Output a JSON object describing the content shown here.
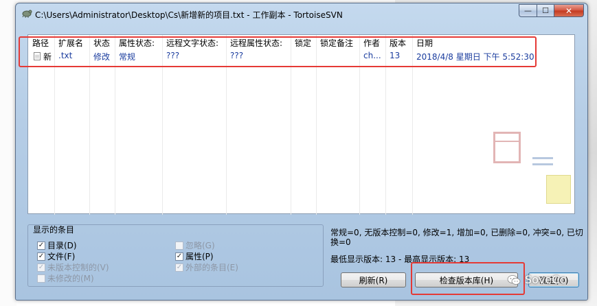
{
  "window": {
    "title": "C:\\Users\\Administrator\\Desktop\\Cs\\新增新的项目.txt - 工作副本 - TortoiseSVN",
    "min_glyph": "—",
    "max_glyph": "☐",
    "close_glyph": "✕"
  },
  "list": {
    "columns": [
      "路径",
      "扩展名",
      "状态",
      "属性状态:",
      "远程文字状态:",
      "远程属性状态:",
      "锁定",
      "锁定备注",
      "作者",
      "版本",
      "日期"
    ],
    "rows": [
      {
        "path": "新",
        "ext": ".txt",
        "status": "修改",
        "prop_status": "常规",
        "remote_text_status": "???",
        "remote_prop_status": "???",
        "lock": "",
        "lock_comment": "",
        "author": "ch...",
        "revision": "13",
        "date": "2018/4/8 星期日 下午 5:52:30"
      }
    ]
  },
  "filters": {
    "title": "显示的条目",
    "items": [
      {
        "label": "目录(D)",
        "checked": true,
        "enabled": true
      },
      {
        "label": "文件(F)",
        "checked": true,
        "enabled": true
      },
      {
        "label": "未版本控制的(V)",
        "checked": true,
        "enabled": false
      },
      {
        "label": "未修改的(M)",
        "checked": false,
        "enabled": false
      },
      {
        "label": "忽略(G)",
        "checked": false,
        "enabled": false
      },
      {
        "label": "属性(P)",
        "checked": true,
        "enabled": true
      },
      {
        "label": "外部的条目(E)",
        "checked": true,
        "enabled": false
      }
    ]
  },
  "status": {
    "summary": "常规=0, 无版本控制=0, 修改=1, 增加=0, 已删除=0, 冲突=0, 已切换=0",
    "revisions": "最低显示版本: 13 - 最高显示版本: 13"
  },
  "buttons": {
    "refresh": "刷新(R)",
    "check_repo": "检查版本库(H)",
    "ok": "确定(O)"
  },
  "watermark": "SoveCc",
  "colors": {
    "highlight_box": "#e53935",
    "link_blue": "#1a3c9e"
  }
}
